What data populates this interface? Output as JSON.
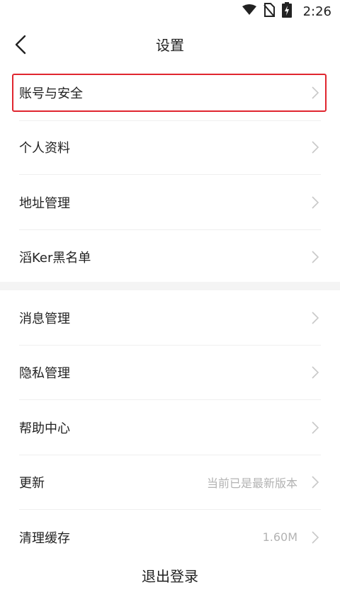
{
  "status_bar": {
    "time": "2:26",
    "icons": [
      "wifi-icon",
      "no-sim-icon",
      "battery-charging-icon"
    ]
  },
  "nav": {
    "title": "设置",
    "back_icon": "chevron-left-icon"
  },
  "group1": [
    {
      "label": "账号与安全",
      "highlighted": true
    },
    {
      "label": "个人资料"
    },
    {
      "label": "地址管理"
    },
    {
      "label": "滔Ker黑名单"
    }
  ],
  "group2": [
    {
      "label": "消息管理"
    },
    {
      "label": "隐私管理"
    },
    {
      "label": "帮助中心"
    },
    {
      "label": "更新",
      "value": "当前已是最新版本"
    },
    {
      "label": "清理缓存",
      "value": "1.60M"
    }
  ],
  "logout_label": "退出登录",
  "colors": {
    "highlight_border": "#e0262f",
    "secondary_text": "#b3b3b3",
    "chevron": "#c8c8c8"
  }
}
